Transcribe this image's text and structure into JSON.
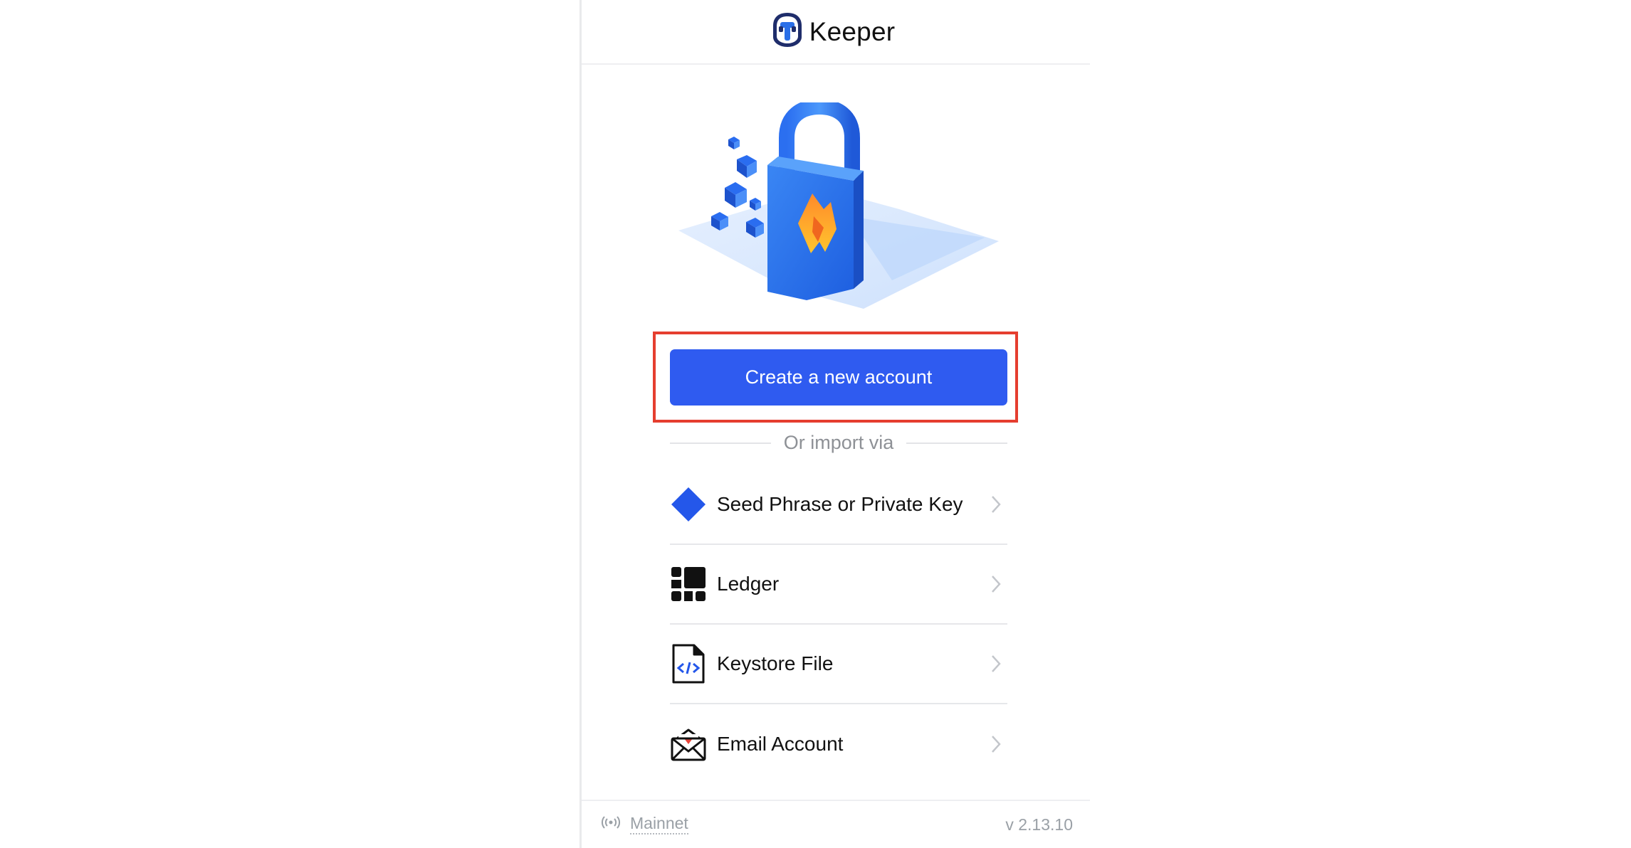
{
  "app": {
    "brand_title": "Keeper"
  },
  "main": {
    "create_button_label": "Create a new account",
    "import_divider_text": "Or import via",
    "import_options": [
      {
        "label": "Seed Phrase or Private Key",
        "icon": "diamond-icon"
      },
      {
        "label": "Ledger",
        "icon": "ledger-icon"
      },
      {
        "label": "Keystore File",
        "icon": "code-file-icon"
      },
      {
        "label": "Email Account",
        "icon": "envelope-icon"
      }
    ]
  },
  "footer": {
    "network_label": "Mainnet",
    "network_icon": "broadcast-icon",
    "version": "v 2.13.10"
  },
  "colors": {
    "accent": "#2f5bf0",
    "highlight": "#e53e2f"
  }
}
